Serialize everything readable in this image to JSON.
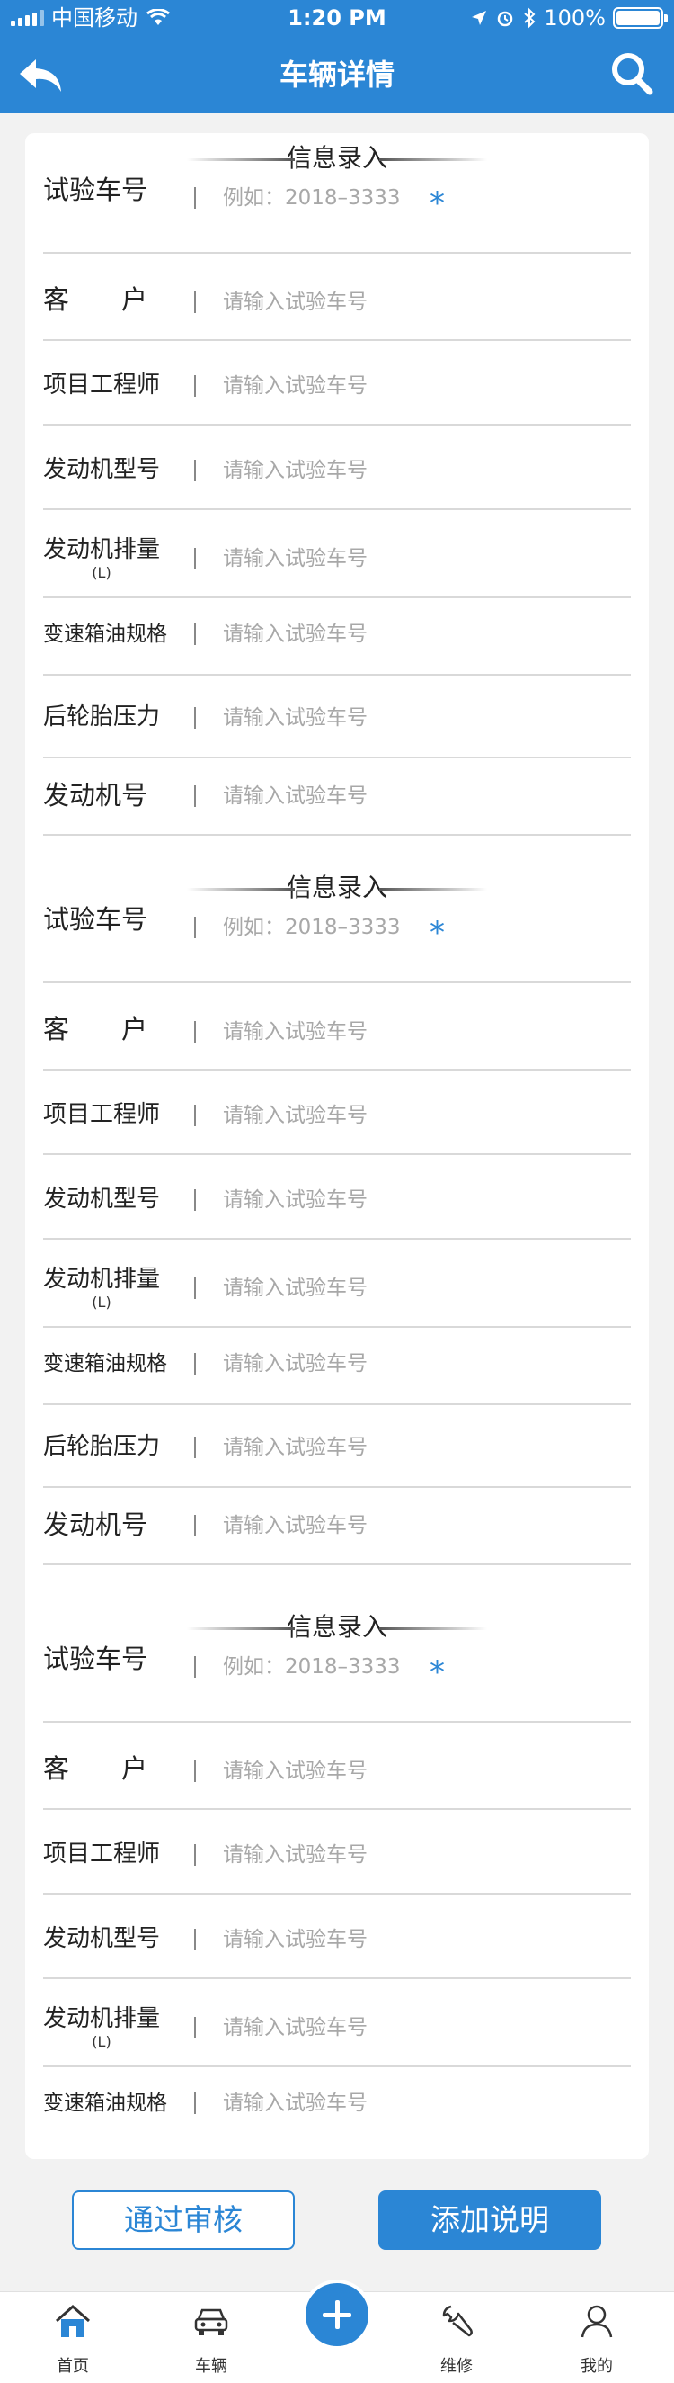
{
  "status_bar": {
    "carrier": "中国移动",
    "time": "1:20 PM",
    "battery": "100%"
  },
  "header": {
    "title": "车辆详情"
  },
  "sections": [
    {
      "title": "信息录入",
      "fields": [
        {
          "label": "试验车号",
          "placeholder": "例如：2018–3333",
          "required_mark": "*"
        },
        {
          "label": "客　　户",
          "placeholder": "请输入试验车号"
        },
        {
          "label": "项目工程师",
          "placeholder": "请输入试验车号"
        },
        {
          "label": "发动机型号",
          "placeholder": "请输入试验车号"
        },
        {
          "label": "发动机排量",
          "unit": "(L)",
          "placeholder": "请输入试验车号"
        },
        {
          "label": "变速箱油规格",
          "placeholder": "请输入试验车号"
        },
        {
          "label": "后轮胎压力",
          "placeholder": "请输入试验车号"
        },
        {
          "label": "发动机号",
          "placeholder": "请输入试验车号"
        }
      ]
    },
    {
      "title": "信息录入",
      "fields": [
        {
          "label": "试验车号",
          "placeholder": "例如：2018–3333",
          "required_mark": "*"
        },
        {
          "label": "客　　户",
          "placeholder": "请输入试验车号"
        },
        {
          "label": "项目工程师",
          "placeholder": "请输入试验车号"
        },
        {
          "label": "发动机型号",
          "placeholder": "请输入试验车号"
        },
        {
          "label": "发动机排量",
          "unit": "(L)",
          "placeholder": "请输入试验车号"
        },
        {
          "label": "变速箱油规格",
          "placeholder": "请输入试验车号"
        },
        {
          "label": "后轮胎压力",
          "placeholder": "请输入试验车号"
        },
        {
          "label": "发动机号",
          "placeholder": "请输入试验车号"
        }
      ]
    },
    {
      "title": "信息录入",
      "fields": [
        {
          "label": "试验车号",
          "placeholder": "例如：2018–3333",
          "required_mark": "*"
        },
        {
          "label": "客　　户",
          "placeholder": "请输入试验车号"
        },
        {
          "label": "项目工程师",
          "placeholder": "请输入试验车号"
        },
        {
          "label": "发动机型号",
          "placeholder": "请输入试验车号"
        },
        {
          "label": "发动机排量",
          "unit": "(L)",
          "placeholder": "请输入试验车号"
        },
        {
          "label": "变速箱油规格",
          "placeholder": "请输入试验车号"
        }
      ]
    }
  ],
  "actions": {
    "approve_label": "通过审核",
    "add_note_label": "添加说明"
  },
  "tabbar": {
    "home": "首页",
    "vehicle": "车辆",
    "repair": "维修",
    "mine": "我的"
  },
  "colors": {
    "primary": "#2b86d5",
    "background": "#f2f2f2"
  },
  "icons": [
    "back-arrow-icon",
    "search-icon",
    "home-icon",
    "car-icon",
    "plus-icon",
    "wrench-icon",
    "user-icon"
  ]
}
